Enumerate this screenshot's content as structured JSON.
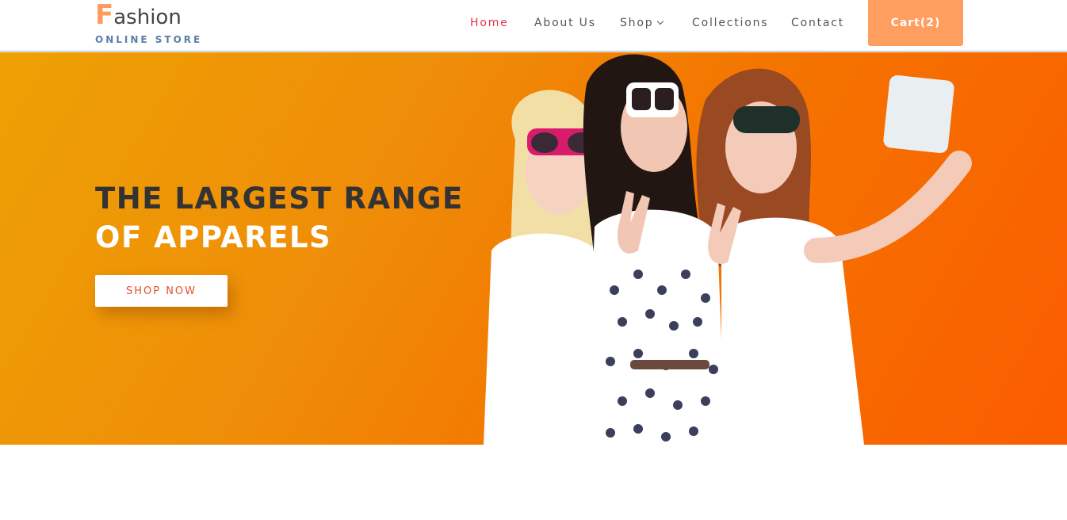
{
  "brand": {
    "logo_initial": "F",
    "logo_rest": "ashion",
    "tagline": "ONLINE STORE"
  },
  "nav": {
    "items": [
      {
        "label": "Home",
        "active": true
      },
      {
        "label": "About Us",
        "active": false
      },
      {
        "label": "Shop",
        "active": false,
        "has_dropdown": true
      },
      {
        "label": "Collections",
        "active": false
      },
      {
        "label": "Contact",
        "active": false
      }
    ],
    "cart_label": "Cart(2)"
  },
  "hero": {
    "title_line1": "THE LARGEST RANGE",
    "title_line2": "OF APPARELS",
    "cta_label": "SHOP NOW"
  },
  "colors": {
    "accent": "#ff9e5e",
    "nav_active": "#e8334a",
    "hero_gradient_start": "#eea104",
    "hero_gradient_end": "#fb5c00",
    "cta_text": "#e8502a"
  },
  "icons": {
    "shop_dropdown": "chevron-down-icon"
  }
}
